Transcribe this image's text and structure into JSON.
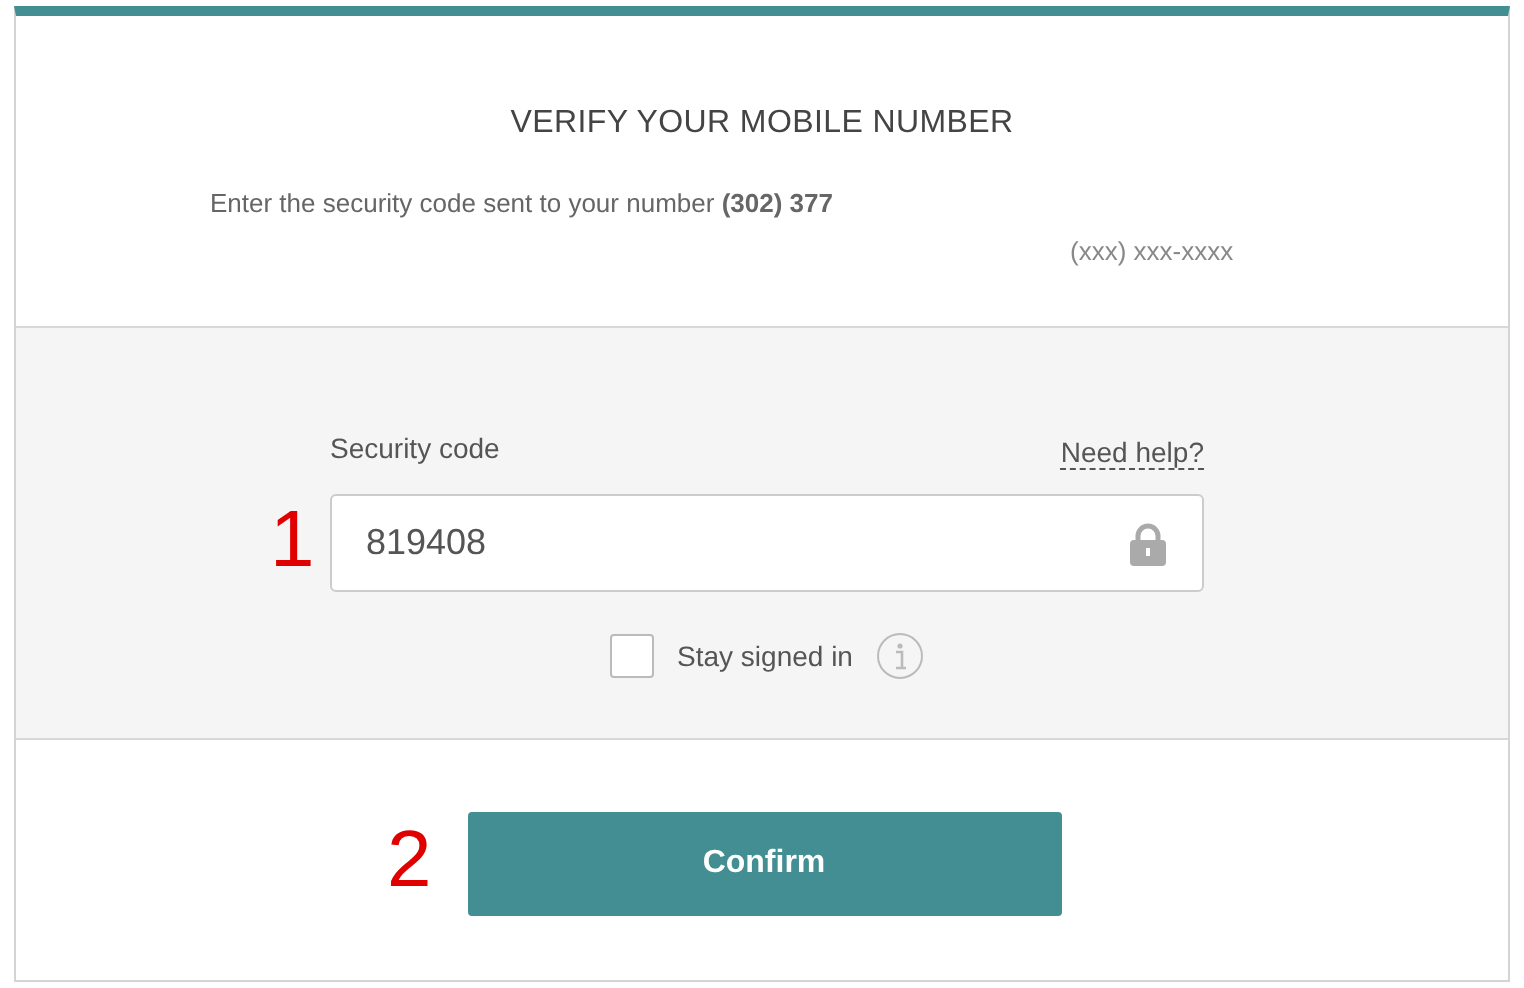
{
  "title": "VERIFY YOUR MOBILE NUMBER",
  "intro": "Enter the security code sent to your number **(302) 377**",
  "phone_mask": "(xxx) xxx-xxxx",
  "field": {
    "label": "Security code",
    "help_link": "Need help?",
    "value": "819408",
    "marker": "1"
  },
  "stay_signed_in": {
    "label": "Stay signed in",
    "checked": false
  },
  "confirm": {
    "label": "Confirm",
    "marker": "2"
  }
}
